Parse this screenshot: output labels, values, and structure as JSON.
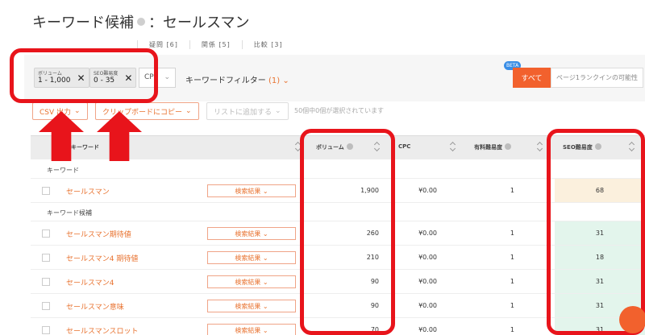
{
  "title": {
    "main": "キーワード候補",
    "keyword": "：セールスマン"
  },
  "subtabs": [
    "疑問 [6]",
    "関係 [5]",
    "比較 [3]"
  ],
  "filters": {
    "chips": [
      {
        "label": "ボリューム",
        "value": "1 - 1,000"
      },
      {
        "label": "SEO難易度",
        "value": "0 - 35"
      }
    ],
    "column_select": "CP",
    "keyword_filter_label": "キーワードフィルター",
    "keyword_filter_count": "(1)",
    "beta_badge": "BETA",
    "all_tab": "すべて",
    "rank_tab": "ページ1ランクインの可能性"
  },
  "actions": {
    "csv": "CSV 出力",
    "clipboard": "クリップボードにコピー",
    "add_list": "リストに追加する",
    "selected_count": "50個中0個が選択されています"
  },
  "table": {
    "headers": {
      "keyword": "キーワード",
      "volume": "ボリューム",
      "cpc": "CPC",
      "paid": "有料難易度",
      "seo": "SEO難易度"
    },
    "section_seed": "キーワード",
    "section_candidates": "キーワード候補",
    "serp_button": "検索結果",
    "seed_row": {
      "keyword": "セールスマン",
      "volume": "1,900",
      "cpc": "¥0.00",
      "paid": "1",
      "seo": "68",
      "seo_color": "#fbf0dd"
    },
    "rows": [
      {
        "keyword": "セールスマン期待値",
        "volume": "260",
        "cpc": "¥0.00",
        "paid": "1",
        "seo": "31",
        "seo_color": "#e3f5ec"
      },
      {
        "keyword": "セールスマン4 期待値",
        "volume": "210",
        "cpc": "¥0.00",
        "paid": "1",
        "seo": "18",
        "seo_color": "#e3f5ec"
      },
      {
        "keyword": "セールスマン4",
        "volume": "90",
        "cpc": "¥0.00",
        "paid": "1",
        "seo": "31",
        "seo_color": "#e3f5ec"
      },
      {
        "keyword": "セールスマン意味",
        "volume": "90",
        "cpc": "¥0.00",
        "paid": "1",
        "seo": "31",
        "seo_color": "#e3f5ec"
      },
      {
        "keyword": "セールスマンスロット",
        "volume": "70",
        "cpc": "¥0.00",
        "paid": "1",
        "seo": "31",
        "seo_color": "#e3f5ec"
      }
    ]
  },
  "colors": {
    "accent": "#f2612d",
    "annotation": "#e8141b"
  }
}
